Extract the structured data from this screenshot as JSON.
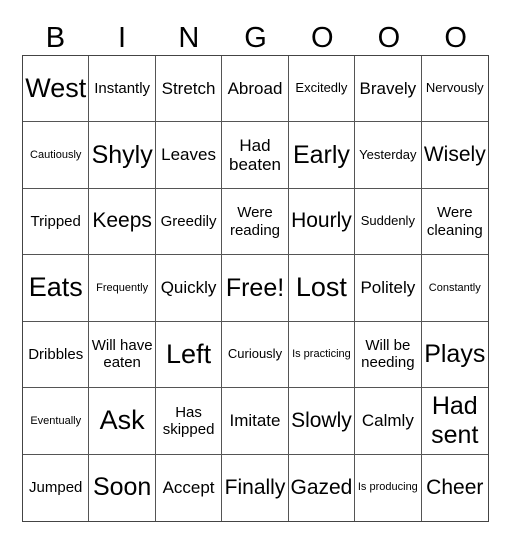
{
  "header": [
    "B",
    "I",
    "N",
    "G",
    "O",
    "O",
    "O"
  ],
  "grid": [
    [
      {
        "t": "West",
        "s": 7
      },
      {
        "t": "Instantly",
        "s": 3
      },
      {
        "t": "Stretch",
        "s": 4
      },
      {
        "t": "Abroad",
        "s": 4
      },
      {
        "t": "Excitedly",
        "s": 2
      },
      {
        "t": "Bravely",
        "s": 4
      },
      {
        "t": "Nervously",
        "s": 2
      }
    ],
    [
      {
        "t": "Cautiously",
        "s": 1
      },
      {
        "t": "Shyly",
        "s": 6
      },
      {
        "t": "Leaves",
        "s": 4
      },
      {
        "t": "Had beaten",
        "s": 4
      },
      {
        "t": "Early",
        "s": 6
      },
      {
        "t": "Yesterday",
        "s": 2
      },
      {
        "t": "Wisely",
        "s": 5
      }
    ],
    [
      {
        "t": "Tripped",
        "s": 3
      },
      {
        "t": "Keeps",
        "s": 5
      },
      {
        "t": "Greedily",
        "s": 3
      },
      {
        "t": "Were reading",
        "s": 3
      },
      {
        "t": "Hourly",
        "s": 5
      },
      {
        "t": "Suddenly",
        "s": 2
      },
      {
        "t": "Were cleaning",
        "s": 3
      }
    ],
    [
      {
        "t": "Eats",
        "s": 7
      },
      {
        "t": "Frequently",
        "s": 1
      },
      {
        "t": "Quickly",
        "s": 4
      },
      {
        "t": "Free!",
        "s": 6
      },
      {
        "t": "Lost",
        "s": 7
      },
      {
        "t": "Politely",
        "s": 4
      },
      {
        "t": "Constantly",
        "s": 1
      }
    ],
    [
      {
        "t": "Dribbles",
        "s": 3
      },
      {
        "t": "Will have eaten",
        "s": 3
      },
      {
        "t": "Left",
        "s": 7
      },
      {
        "t": "Curiously",
        "s": 2
      },
      {
        "t": "Is practicing",
        "s": 1
      },
      {
        "t": "Will be needing",
        "s": 3
      },
      {
        "t": "Plays",
        "s": 6
      }
    ],
    [
      {
        "t": "Eventually",
        "s": 1
      },
      {
        "t": "Ask",
        "s": 7
      },
      {
        "t": "Has skipped",
        "s": 3
      },
      {
        "t": "Imitate",
        "s": 4
      },
      {
        "t": "Slowly",
        "s": 5
      },
      {
        "t": "Calmly",
        "s": 4
      },
      {
        "t": "Had sent",
        "s": 6
      }
    ],
    [
      {
        "t": "Jumped",
        "s": 3
      },
      {
        "t": "Soon",
        "s": 6
      },
      {
        "t": "Accept",
        "s": 4
      },
      {
        "t": "Finally",
        "s": 5
      },
      {
        "t": "Gazed",
        "s": 5
      },
      {
        "t": "Is producing",
        "s": 1
      },
      {
        "t": "Cheer",
        "s": 5
      }
    ]
  ]
}
